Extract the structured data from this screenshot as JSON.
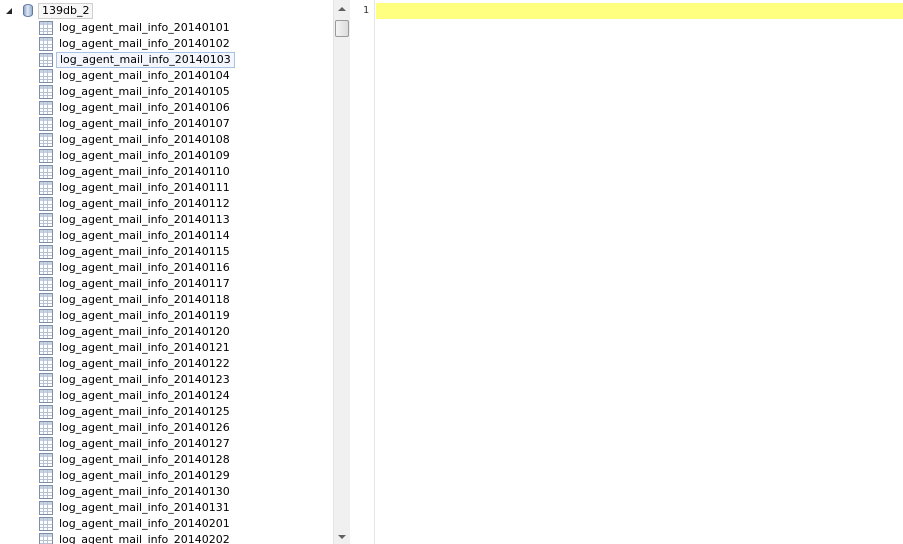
{
  "tree": {
    "database": "139db_2",
    "selected_table": "log_agent_mail_info_20140103",
    "tables": [
      "log_agent_mail_info_20140101",
      "log_agent_mail_info_20140102",
      "log_agent_mail_info_20140103",
      "log_agent_mail_info_20140104",
      "log_agent_mail_info_20140105",
      "log_agent_mail_info_20140106",
      "log_agent_mail_info_20140107",
      "log_agent_mail_info_20140108",
      "log_agent_mail_info_20140109",
      "log_agent_mail_info_20140110",
      "log_agent_mail_info_20140111",
      "log_agent_mail_info_20140112",
      "log_agent_mail_info_20140113",
      "log_agent_mail_info_20140114",
      "log_agent_mail_info_20140115",
      "log_agent_mail_info_20140116",
      "log_agent_mail_info_20140117",
      "log_agent_mail_info_20140118",
      "log_agent_mail_info_20140119",
      "log_agent_mail_info_20140120",
      "log_agent_mail_info_20140121",
      "log_agent_mail_info_20140122",
      "log_agent_mail_info_20140123",
      "log_agent_mail_info_20140124",
      "log_agent_mail_info_20140125",
      "log_agent_mail_info_20140126",
      "log_agent_mail_info_20140127",
      "log_agent_mail_info_20140128",
      "log_agent_mail_info_20140129",
      "log_agent_mail_info_20140130",
      "log_agent_mail_info_20140131",
      "log_agent_mail_info_20140201",
      "log_agent_mail_info_20140202"
    ]
  },
  "editor": {
    "line_numbers": [
      "1"
    ],
    "current_line_color": "#ffff80"
  },
  "icons": {
    "database": "database-icon",
    "table": "table-icon",
    "expand": "triangle-right-icon",
    "collapse": "triangle-down-icon"
  }
}
